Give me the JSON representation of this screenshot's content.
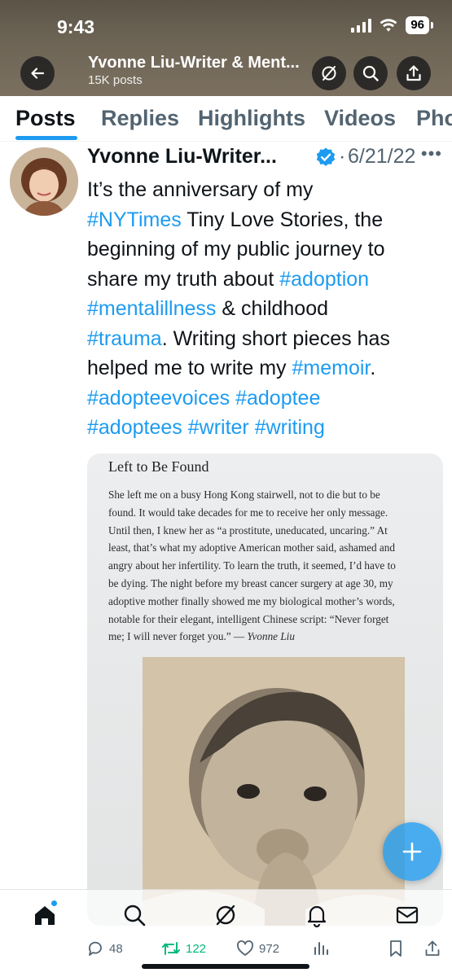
{
  "status_bar": {
    "time": "9:43",
    "battery": "96"
  },
  "header": {
    "title": "Yvonne Liu-Writer & Ment...",
    "subtitle": "15K posts"
  },
  "tabs": [
    "Posts",
    "Replies",
    "Highlights",
    "Videos",
    "Pho"
  ],
  "post": {
    "author": "Yvonne Liu-Writer...",
    "separator": "·",
    "date": "6/21/22",
    "more": "•••",
    "lines": [
      [
        {
          "t": "It’s the anniversary of my",
          "tag": false
        }
      ],
      [
        {
          "t": "#NYTimes",
          "tag": true
        },
        {
          "t": " Tiny Love Stories, the",
          "tag": false
        }
      ],
      [
        {
          "t": "beginning of my public journey to",
          "tag": false
        }
      ],
      [
        {
          "t": "share my truth about ",
          "tag": false
        },
        {
          "t": "#adoption",
          "tag": true
        }
      ],
      [
        {
          "t": "#mentalillness",
          "tag": true
        },
        {
          "t": " & childhood",
          "tag": false
        }
      ],
      [
        {
          "t": "#trauma",
          "tag": true
        },
        {
          "t": ". Writing short pieces has",
          "tag": false
        }
      ],
      [
        {
          "t": "helped me to write my ",
          "tag": false
        },
        {
          "t": "#memoir",
          "tag": true
        },
        {
          "t": ".",
          "tag": false
        }
      ],
      [
        {
          "t": "#adopteevoices",
          "tag": true
        },
        {
          "t": " ",
          "tag": false
        },
        {
          "t": "#adoptee",
          "tag": true
        }
      ],
      [
        {
          "t": "#adoptees",
          "tag": true
        },
        {
          "t": " ",
          "tag": false
        },
        {
          "t": "#writer",
          "tag": true
        },
        {
          "t": " ",
          "tag": false
        },
        {
          "t": "#writing",
          "tag": true
        }
      ]
    ]
  },
  "media": {
    "title": "Left to Be Found",
    "body_lines": [
      "She left me on a busy Hong Kong stairwell, not to die but to be",
      "found. It would take decades for me to receive her only message.",
      "Until then, I knew her as “a prostitute, uneducated, uncaring.” At",
      "least, that’s what my adoptive American mother said, ashamed and",
      "angry about her infertility. To learn the truth, it seemed, I’d have to",
      "be dying. The night before my breast cancer surgery at age 30, my",
      "adoptive mother finally showed me my biological mother’s words,",
      "notable for their elegant, intelligent Chinese script: “Never forget"
    ],
    "last_line": "me; I will never forget you.” — ",
    "signature": "Yvonne Liu"
  },
  "actions": {
    "replies": "48",
    "reposts": "122",
    "likes": "972"
  },
  "colors": {
    "accent": "#1d9bf0",
    "repost": "#00ba7c",
    "muted": "#536471"
  },
  "icons": {
    "back": "arrow-left-icon",
    "grok": "grok-icon",
    "search": "search-icon",
    "share": "share-icon",
    "verified": "verified-badge-icon",
    "compose": "plus-icon"
  }
}
